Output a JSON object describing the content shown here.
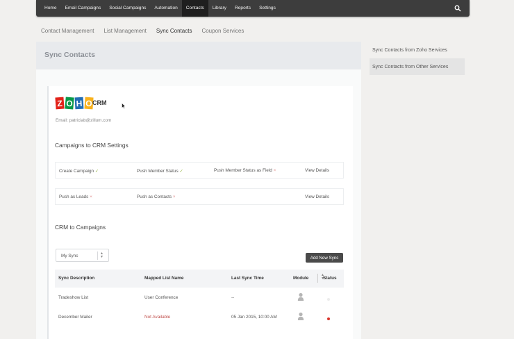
{
  "topnav": {
    "items": [
      "Home",
      "Email Campaigns",
      "Social Campaigns",
      "Automation",
      "Contacts",
      "Library",
      "Reports",
      "Settings"
    ],
    "active": "Contacts",
    "search_icon": "search-icon"
  },
  "subnav": {
    "items": [
      "Contact Management",
      "List Management",
      "Sync Contacts",
      "Coupon Services"
    ],
    "active": "Sync Contacts"
  },
  "page": {
    "title": "Sync Contacts"
  },
  "crm": {
    "logo_letters": [
      "Z",
      "O",
      "H",
      "O"
    ],
    "logo_colors": [
      "#e2231a",
      "#089949",
      "#226db4",
      "#f9b21d"
    ],
    "label": "CRM",
    "email": "Email: patriciab@zillum.com"
  },
  "settings": {
    "title": "Campaigns to CRM Settings",
    "row1": {
      "create_campaign": "Create Campaign",
      "push_member_status": "Push Member Status",
      "push_member_status_field": "Push Member Status as Field",
      "view_details": "View Details"
    },
    "row2": {
      "push_leads": "Push as Leads",
      "push_contacts": "Push as Contacts",
      "view_details": "View Details"
    },
    "check": "✓",
    "cross": "×"
  },
  "crm_to_campaigns": {
    "title": "CRM to Campaigns",
    "filter_value": "My Sync",
    "add_button": "Add New Sync",
    "columns": [
      "Sync Description",
      "Mapped List Name",
      "Last Sync Time",
      "Module",
      "Status"
    ],
    "rows": [
      {
        "description": "Tradeshow List",
        "list": "User Conference",
        "time": "--",
        "status_color": "#ececec"
      },
      {
        "description": "December Mailer",
        "list": "Not Available",
        "time": "05 Jan 2015, 10:00 AM",
        "status_color": "#d9342b"
      }
    ]
  },
  "sidebar": {
    "items": [
      "Sync Contacts from Zoho Services",
      "Sync Contacts from Other Services"
    ],
    "active": "Sync Contacts from Other Services"
  }
}
